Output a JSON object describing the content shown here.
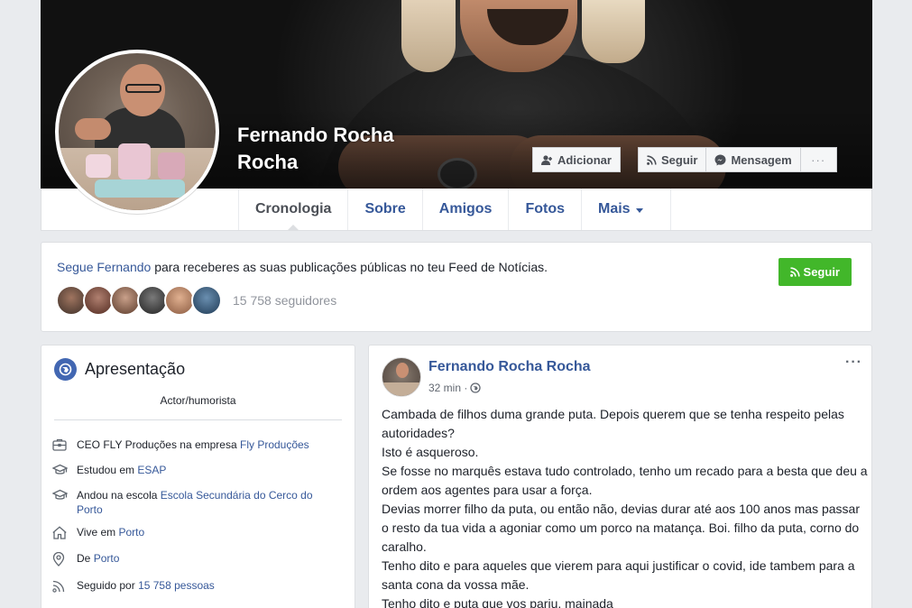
{
  "profile": {
    "name_line1": "Fernando Rocha",
    "name_line2": "Rocha"
  },
  "cover_buttons": {
    "add": "Adicionar",
    "follow": "Seguir",
    "message": "Mensagem",
    "more": "···"
  },
  "tabs": [
    "Cronologia",
    "Sobre",
    "Amigos",
    "Fotos",
    "Mais"
  ],
  "follow_box": {
    "link": "Segue Fernando",
    "text": " para receberes as suas publicações públicas no teu Feed de Notícias.",
    "button": "Seguir",
    "followers": "15 758 seguidores"
  },
  "intro": {
    "title": "Apresentação",
    "subtitle": "Actor/humorista",
    "items": [
      {
        "icon": "briefcase-icon",
        "text": "CEO FLY Produções na empresa ",
        "link": "Fly Produções"
      },
      {
        "icon": "graduation-cap-icon",
        "text": "Estudou em ",
        "link": "ESAP"
      },
      {
        "icon": "graduation-cap-icon",
        "text": "Andou na escola ",
        "link": "Escola Secundária do Cerco do Porto"
      },
      {
        "icon": "home-icon",
        "text": "Vive em ",
        "link": "Porto"
      },
      {
        "icon": "location-pin-icon",
        "text": "De ",
        "link": "Porto"
      },
      {
        "icon": "rss-icon",
        "text": "Seguido por ",
        "link": "15 758 pessoas"
      }
    ]
  },
  "post": {
    "author": "Fernando Rocha Rocha",
    "time": "32 min ·",
    "more": "···",
    "lines": [
      "Cambada de filhos duma grande puta. Depois querem que se tenha respeito pelas autoridades?",
      "Isto é asqueroso.",
      "Se fosse no marquês estava tudo controlado, tenho um recado para a besta que deu a ordem aos agentes para usar a força.",
      "Devias morrer filho da puta, ou então não, devias durar até aos 100 anos mas passar o resto da tua vida a agoniar como um porco na matança. Boi. filho da puta, corno do caralho.",
      "Tenho dito e para aqueles que vierem para aqui justificar o covid, ide tambem para a santa cona da vossa mãe.",
      "Tenho dito e puta que vos pariu, mainada"
    ]
  },
  "colors": {
    "link": "#365899",
    "follow_green": "#42b72a",
    "background": "#e9ebee"
  }
}
